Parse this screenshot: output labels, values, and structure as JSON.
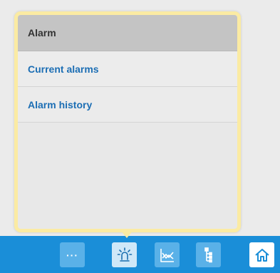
{
  "alarm_menu": {
    "title": "Alarm",
    "items": [
      {
        "label": "Current alarms"
      },
      {
        "label": "Alarm history"
      }
    ]
  },
  "toolbar": {
    "more_glyph": "···",
    "buttons": [
      {
        "icon": "more-icon",
        "active": false
      },
      {
        "icon": "alarm-beacon-icon",
        "active": true
      },
      {
        "icon": "trend-chart-icon",
        "active": false
      },
      {
        "icon": "tree-structure-icon",
        "active": false
      },
      {
        "icon": "home-icon",
        "active": false
      }
    ]
  },
  "colors": {
    "toolbar_bg": "#1a8ed8",
    "button_bg": "#5ab1e8",
    "active_button_bg": "#cfe8f8",
    "popover_border": "#fbeba3",
    "menu_link": "#1c6eb4",
    "menu_header_bg": "#c4c4c4"
  }
}
